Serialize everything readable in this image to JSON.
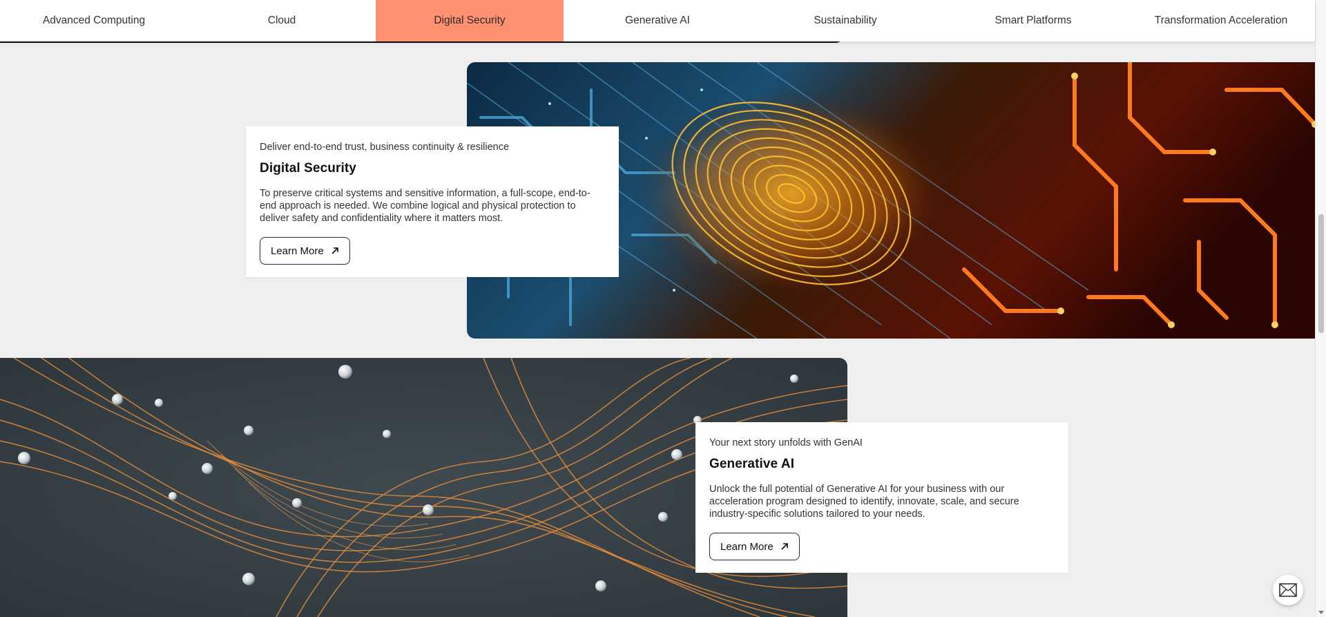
{
  "nav": {
    "tabs": [
      {
        "label": "Advanced Computing"
      },
      {
        "label": "Cloud"
      },
      {
        "label": "Digital Security",
        "active": true
      },
      {
        "label": "Generative AI"
      },
      {
        "label": "Sustainability"
      },
      {
        "label": "Smart Platforms"
      },
      {
        "label": "Transformation Acceleration"
      }
    ],
    "active_color": "#ff9170"
  },
  "sections": {
    "security": {
      "eyebrow": "Deliver end-to-end trust, business continuity & resilience",
      "title": "Digital Security",
      "description": "To preserve critical systems and sensitive information, a full-scope, end-to-end approach is needed. We combine logical and physical protection to deliver safety and confidentiality where it matters most.",
      "button_label": "Learn More",
      "button_icon": "arrow-up-right-icon",
      "image": "fingerprint-circuit-image"
    },
    "genai": {
      "eyebrow": "Your next story unfolds with GenAI",
      "title": "Generative AI",
      "description": "Unlock the full potential of Generative AI for your business with our acceleration program designed to identify, innovate, scale, and secure industry-specific solutions tailored to your needs.",
      "button_label": "Learn More",
      "button_icon": "arrow-up-right-icon",
      "image": "orange-fibers-spheres-image"
    }
  },
  "floating": {
    "icon": "mail-icon"
  }
}
